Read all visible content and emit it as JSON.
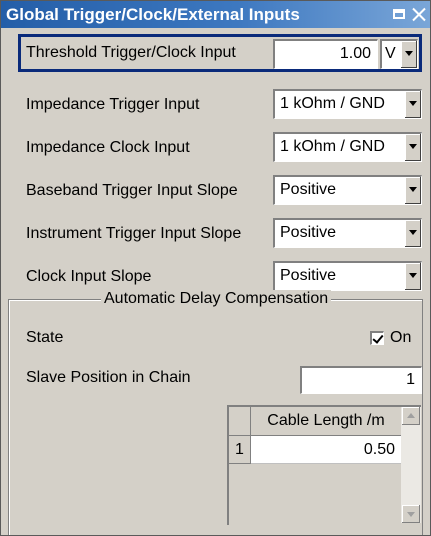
{
  "window": {
    "title": "Global Trigger/Clock/External Inputs"
  },
  "settings": {
    "threshold": {
      "label": "Threshold Trigger/Clock Input",
      "value": "1.00",
      "unit": "V"
    },
    "impedance_trigger": {
      "label": "Impedance Trigger Input",
      "value": "1 kOhm / GND"
    },
    "impedance_clock": {
      "label": "Impedance Clock Input",
      "value": "1 kOhm / GND"
    },
    "baseband_slope": {
      "label": "Baseband Trigger Input Slope",
      "value": "Positive"
    },
    "instrument_slope": {
      "label": "Instrument Trigger Input Slope",
      "value": "Positive"
    },
    "clock_slope": {
      "label": "Clock Input Slope",
      "value": "Positive"
    }
  },
  "delay_compensation": {
    "title": "Automatic Delay Compensation",
    "state_label": "State",
    "state_checked": true,
    "state_checkbox_label": "On",
    "slave_position_label": "Slave Position in Chain",
    "slave_position_value": "1",
    "table": {
      "column_header": "Cable Length /m",
      "rows": [
        {
          "index": "1",
          "value": "0.50"
        }
      ]
    }
  },
  "colors": {
    "titlebar": "#245ea8",
    "panel": "#d4d0c8",
    "focus_border": "#0a2a7a"
  }
}
